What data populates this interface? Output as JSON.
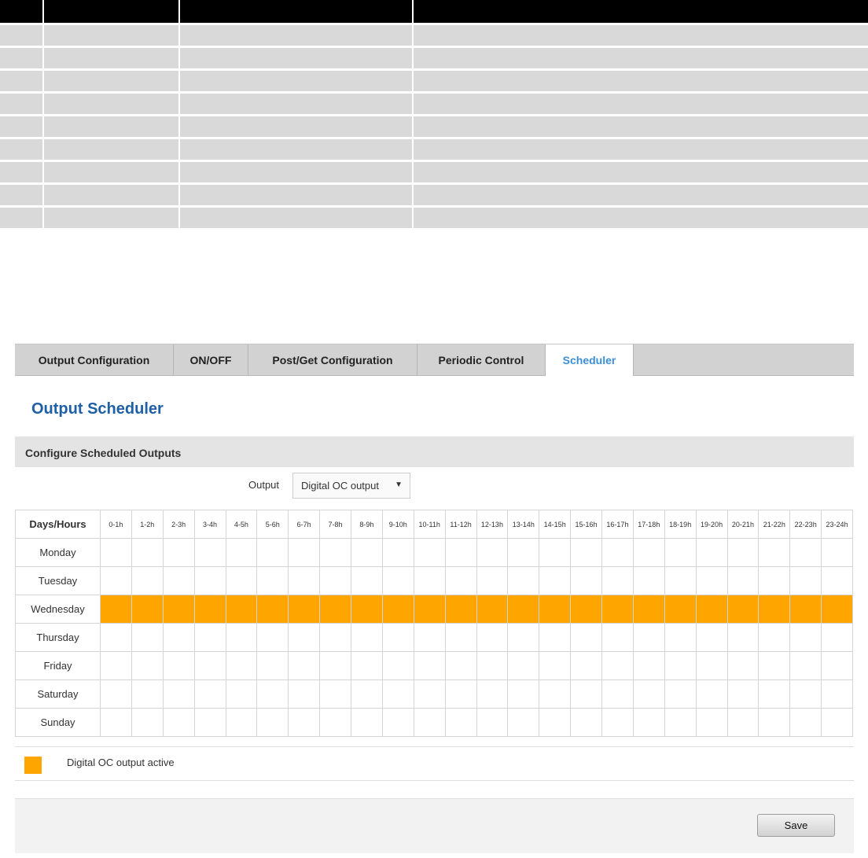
{
  "top_table": {
    "columns": 4,
    "body_rows": 9
  },
  "tabs": [
    {
      "label": "Output Configuration",
      "active": false
    },
    {
      "label": "ON/OFF",
      "active": false
    },
    {
      "label": "Post/Get Configuration",
      "active": false
    },
    {
      "label": "Periodic Control",
      "active": false
    },
    {
      "label": "Scheduler",
      "active": true
    }
  ],
  "page_title": "Output Scheduler",
  "section_title": "Configure Scheduled Outputs",
  "output": {
    "label": "Output",
    "selected": "Digital OC output"
  },
  "schedule": {
    "corner_label": "Days/Hours",
    "hours": [
      "0-1h",
      "1-2h",
      "2-3h",
      "3-4h",
      "4-5h",
      "5-6h",
      "6-7h",
      "7-8h",
      "8-9h",
      "9-10h",
      "10-11h",
      "11-12h",
      "12-13h",
      "13-14h",
      "14-15h",
      "15-16h",
      "16-17h",
      "17-18h",
      "18-19h",
      "19-20h",
      "20-21h",
      "21-22h",
      "22-23h",
      "23-24h"
    ],
    "days": [
      {
        "name": "Monday",
        "active_hours": []
      },
      {
        "name": "Tuesday",
        "active_hours": []
      },
      {
        "name": "Wednesday",
        "active_hours": [
          0,
          1,
          2,
          3,
          4,
          5,
          6,
          7,
          8,
          9,
          10,
          11,
          12,
          13,
          14,
          15,
          16,
          17,
          18,
          19,
          20,
          21,
          22,
          23
        ]
      },
      {
        "name": "Thursday",
        "active_hours": []
      },
      {
        "name": "Friday",
        "active_hours": []
      },
      {
        "name": "Saturday",
        "active_hours": []
      },
      {
        "name": "Sunday",
        "active_hours": []
      }
    ]
  },
  "legend": {
    "label": "Digital OC output active",
    "color": "#ffa500"
  },
  "buttons": {
    "save": "Save"
  },
  "colors": {
    "active_cell": "#ffa500",
    "title_blue": "#1f5fa6",
    "active_tab": "#3b8fd6"
  }
}
